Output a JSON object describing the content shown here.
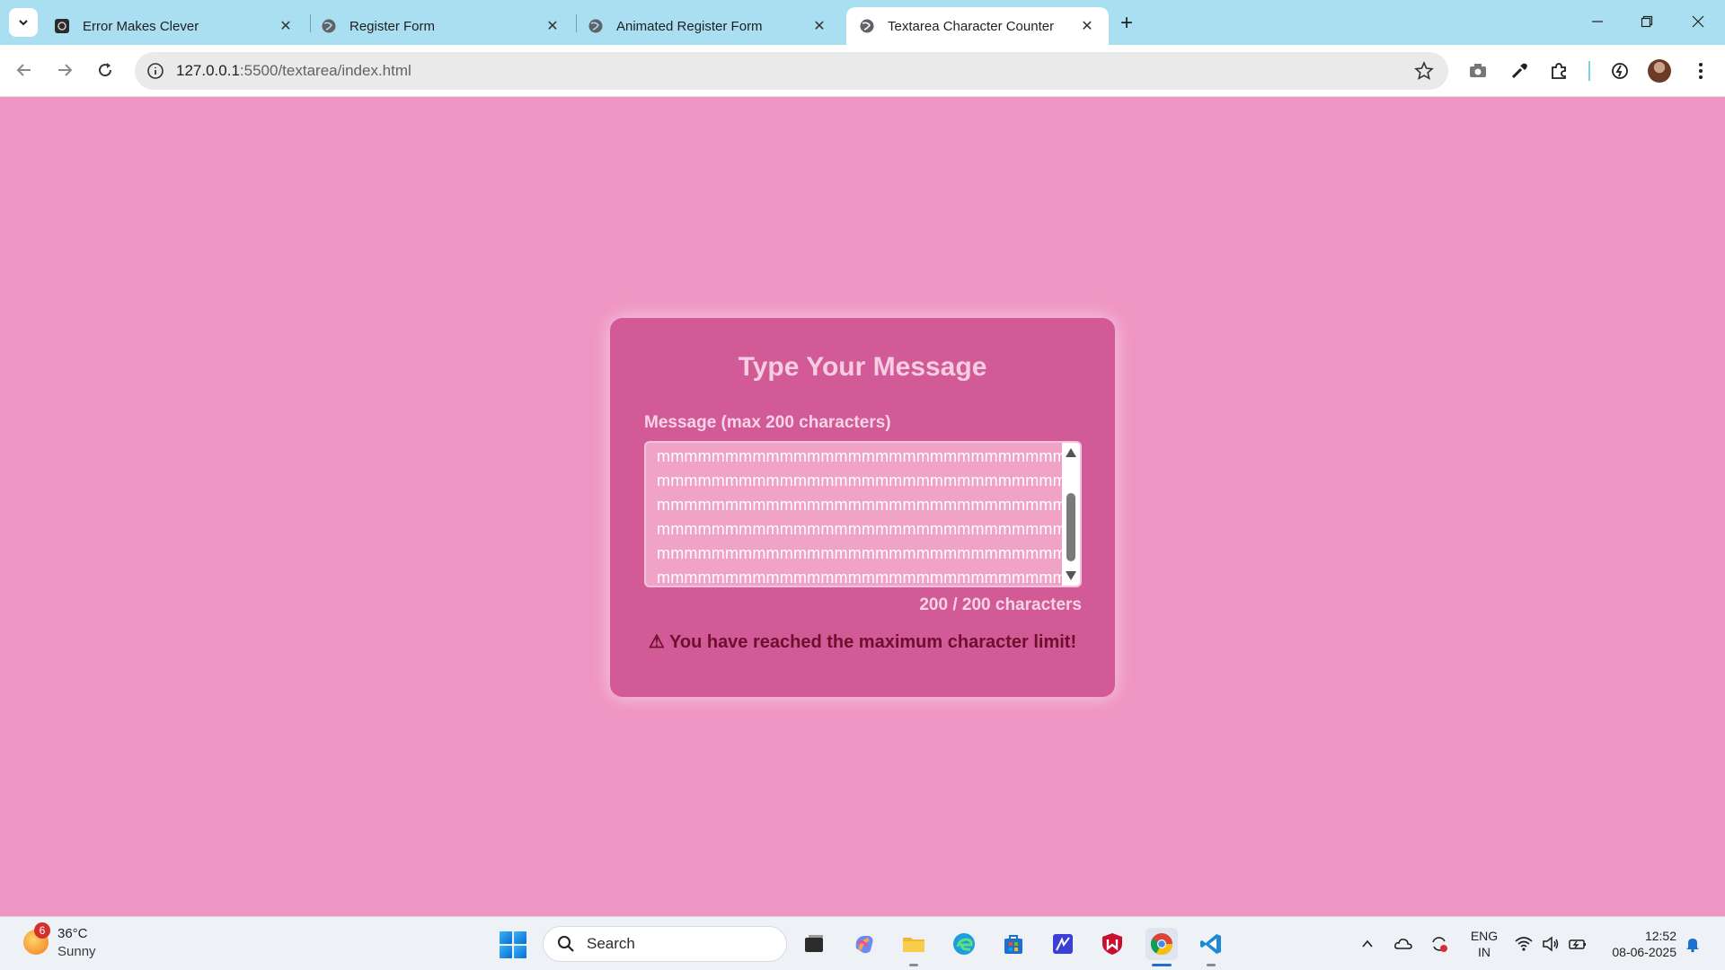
{
  "browser": {
    "tabs": [
      {
        "title": "Error Makes Clever",
        "active": false
      },
      {
        "title": "Register Form",
        "active": false
      },
      {
        "title": "Animated Register Form",
        "active": false
      },
      {
        "title": "Textarea Character Counter",
        "active": true
      }
    ],
    "url_host": "127.0.0.1",
    "url_rest": ":5500/textarea/index.html"
  },
  "page": {
    "heading": "Type Your Message",
    "label": "Message (max 200 characters)",
    "textarea_value": "mmmmmmmmmmmmmmmmmmmmmmmmmmmmmm\nmmmmmmmmmmmmmmmmmmmmmmmmmmmmmm\nmmmmmmmmmmmmmmmmmmmmmmmmmmmmmm\nmmmmmmmmmmmmmmmmmmmmmmmmmmmmmm\nmmmmmmmmmmmmmmmmmmmmmmmmmmmmmm\nmmmmmmmmmmmmmmmmmmmmmmmmmmmmmm",
    "counter": "200 / 200 characters",
    "warning": "⚠ You have reached the maximum character limit!"
  },
  "taskbar": {
    "weather_badge": "6",
    "weather_temp": "36°C",
    "weather_cond": "Sunny",
    "search_placeholder": "Search",
    "lang_line1": "ENG",
    "lang_line2": "IN",
    "time": "12:52",
    "date": "08-06-2025"
  },
  "colors": {
    "page_bg": "#ef95c3",
    "card_bg": "#d15a97",
    "warning_text": "#6e0f2e",
    "tabstrip_bg": "#a9dff0"
  }
}
